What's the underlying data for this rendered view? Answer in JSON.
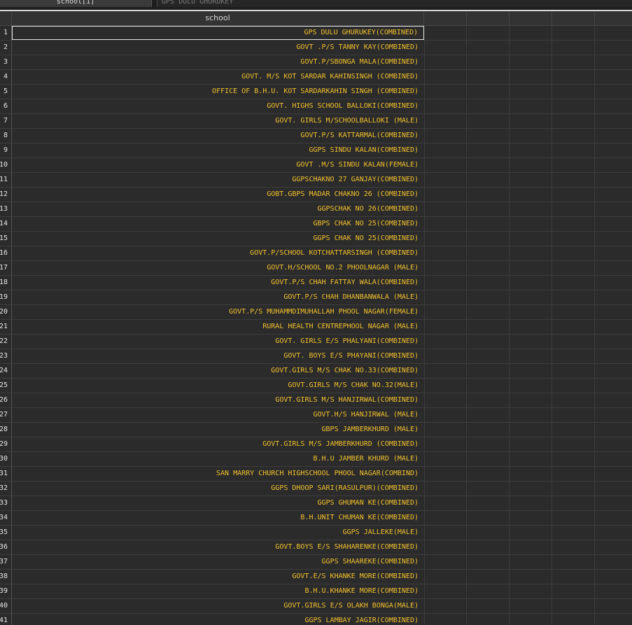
{
  "toolbar": {
    "name_box": "school[1]",
    "formula_value": "GPS DULU GHURUKEY"
  },
  "columns": [
    "school"
  ],
  "rows": [
    {
      "n": "1",
      "v": "GPS DULU GHURUKEY(COMBINED)"
    },
    {
      "n": "2",
      "v": "GOVT .P/S TANNY KAY(COMBINED)"
    },
    {
      "n": "3",
      "v": "GOVT.P/SBONGA MALA(COMBINED)"
    },
    {
      "n": "4",
      "v": "GOVT. M/S KOT SARDAR KAHINSINGH (COMBINED)"
    },
    {
      "n": "5",
      "v": "OFFICE OF B.H.U. KOT SARDARKAHIN SINGH (COMBINED)"
    },
    {
      "n": "6",
      "v": "GOVT. HIGHS SCHOOL BALLOKI(COMBINED)"
    },
    {
      "n": "7",
      "v": "GOVT. GIRLS M/SCHOOLBALLOKI (MALE)"
    },
    {
      "n": "8",
      "v": "GOVT.P/S KATTARMAL(COMBINED)"
    },
    {
      "n": "9",
      "v": "GGPS SINDU KALAN(COMBINED)"
    },
    {
      "n": "10",
      "v": "GOVT .M/S SINDU KALAN(FEMALE)"
    },
    {
      "n": "11",
      "v": "GGPSCHAKNO 27 GANJAY(COMBINED)"
    },
    {
      "n": "12",
      "v": "GOBT.GBPS MADAR CHAKNO 26 (COMBINED)"
    },
    {
      "n": "13",
      "v": "GGPSCHAK NO 26(COMBINED)"
    },
    {
      "n": "14",
      "v": "GBPS CHAK NO 25(COMBINED)"
    },
    {
      "n": "15",
      "v": "GGPS CHAK NO 25(COMBINED)"
    },
    {
      "n": "16",
      "v": "GOVT.P/SCHOOL KOTCHATTARSINGH (COMBINED)"
    },
    {
      "n": "17",
      "v": "GOVT.H/SCHOOL NO.2 PHOOLNAGAR (MALE)"
    },
    {
      "n": "18",
      "v": "GOVT.P/S CHAH FATTAY WALA(COMBINED)"
    },
    {
      "n": "19",
      "v": "GOVT.P/S CHAH DHANBANWALA (MALE)"
    },
    {
      "n": "20",
      "v": "GOVT.P/S MUHAMMDIMUHALLAH PHOOL NAGAR(FEMALE)"
    },
    {
      "n": "21",
      "v": "RURAL HEALTH CENTREPHOOL NAGAR (MALE)"
    },
    {
      "n": "22",
      "v": "GOVT. GIRLS E/S PHALYANI(COMBINED)"
    },
    {
      "n": "23",
      "v": "GOVT. BOYS E/S PHAYANI(COMBINED)"
    },
    {
      "n": "24",
      "v": "GOVT.GIRLS M/S CHAK NO.33(COMBINED)"
    },
    {
      "n": "25",
      "v": "GOVT.GIRLS M/S CHAK NO.32(MALE)"
    },
    {
      "n": "26",
      "v": "GOVT.GIRLS M/S HANJIRWAL(COMBINED)"
    },
    {
      "n": "27",
      "v": "GOVT.H/S HANJIRWAL (MALE)"
    },
    {
      "n": "28",
      "v": "GBPS JAMBERKHURD (MALE)"
    },
    {
      "n": "29",
      "v": "GOVT.GIRLS M/S JAMBERKHURD (COMBINED)"
    },
    {
      "n": "30",
      "v": "B.H.U JAMBER KHURD (MALE)"
    },
    {
      "n": "31",
      "v": "SAN MARRY CHURCH HIGHSCHOOL PHOOL NAGAR(COMBIND)"
    },
    {
      "n": "32",
      "v": "GGPS DHOOP SARI(RASULPUR)(COMBINED)"
    },
    {
      "n": "33",
      "v": "GGPS GHUMAN KE(COMBINED)"
    },
    {
      "n": "34",
      "v": "B.H.UNIT CHUMAN KE(COMBINED)"
    },
    {
      "n": "35",
      "v": "GGPS JALLEKE(MALE)"
    },
    {
      "n": "36",
      "v": "GOVT.BOYS E/S SHAHARENKE(COMBINED)"
    },
    {
      "n": "37",
      "v": "GGPS SHAAREKE(COMBINED)"
    },
    {
      "n": "38",
      "v": "GOVT.E/S KHANKE MORE(COMBINED)"
    },
    {
      "n": "39",
      "v": "B.H.U.KHANKE MORE(COMBINED)"
    },
    {
      "n": "40",
      "v": "GOVT.GIRLS E/S OLAKH BONGA(MALE)"
    },
    {
      "n": "41",
      "v": "GGPS LAMBAY JAGIR(COMBINED)"
    }
  ],
  "colors": {
    "background": "#2b2b2b",
    "cell_text": "#f2c12e",
    "header_bg": "#333333",
    "grid_line": "#3d3d3d"
  }
}
